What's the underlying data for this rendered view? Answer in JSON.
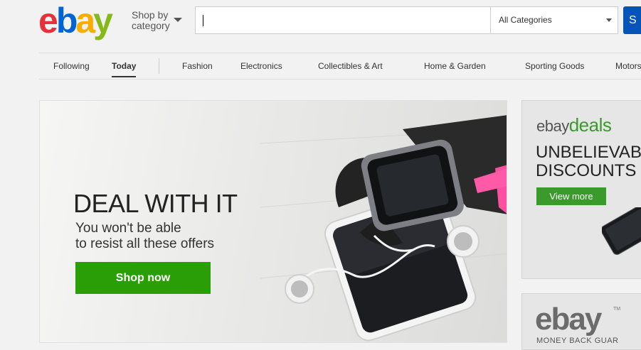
{
  "header": {
    "logo_letters": [
      {
        "letter": "e",
        "color": "#e53238"
      },
      {
        "letter": "b",
        "color": "#0064d2"
      },
      {
        "letter": "a",
        "color": "#f5af02"
      },
      {
        "letter": "y",
        "color": "#86b817"
      }
    ],
    "shop_by_line1": "Shop by",
    "shop_by_line2": "category",
    "search_value": "",
    "category_selected": "All Categories",
    "search_button_label": "S"
  },
  "nav": {
    "items": [
      "Following",
      "Today",
      "Fashion",
      "Electronics",
      "Collectibles & Art",
      "Home & Garden",
      "Sporting Goods",
      "Motors"
    ],
    "active_index": 1
  },
  "hero": {
    "title": "DEAL WITH IT",
    "subtitle_line1": "You won't be able",
    "subtitle_line2": "to resist all these offers",
    "button_label": "Shop now",
    "button_color": "#2a9e06"
  },
  "side_deals": {
    "logo_prefix": "ebay",
    "logo_suffix": "deals",
    "headline_line1": "UNBELIEVABL",
    "headline_line2": "DISCOUNTS",
    "button_label": "View more",
    "accent_color": "#3a9a2c"
  },
  "side_guarantee": {
    "logo": "ebay",
    "tm": "TM",
    "caption": "MONEY BACK GUAR"
  }
}
